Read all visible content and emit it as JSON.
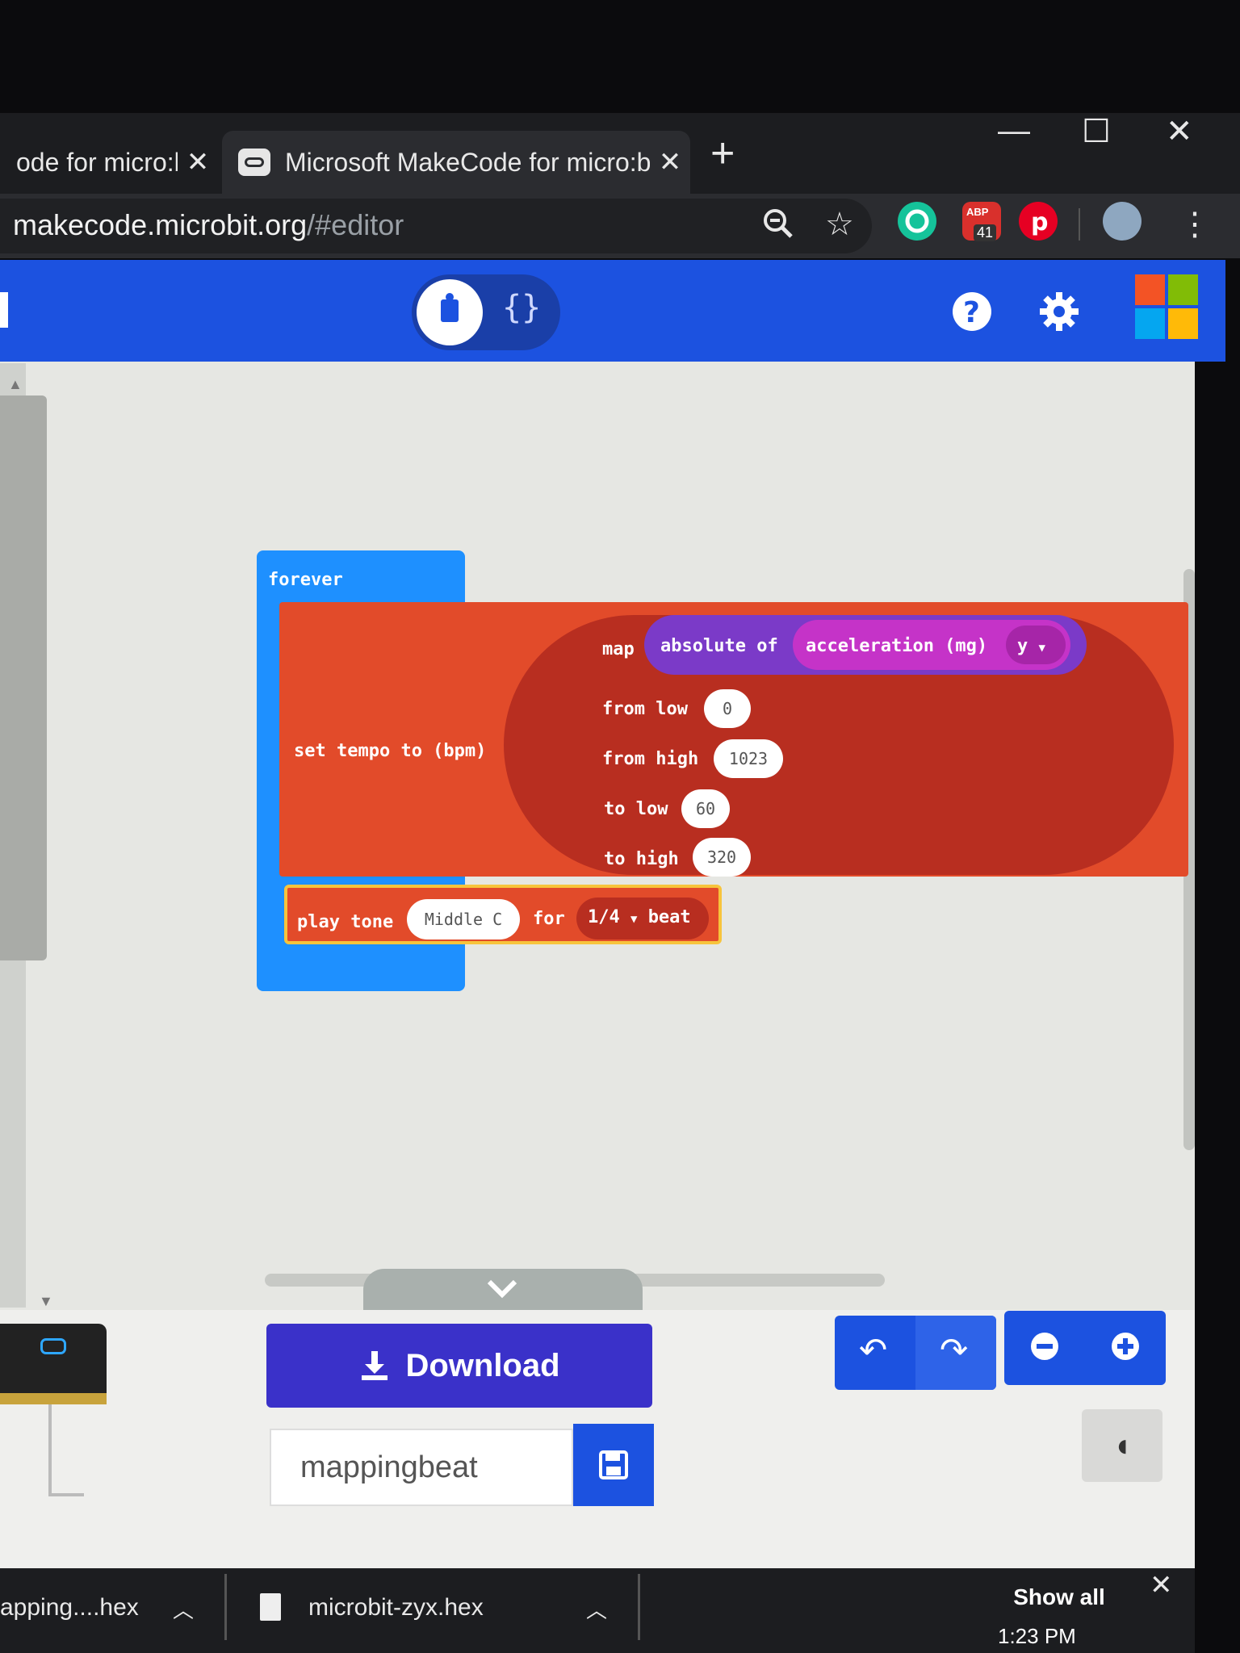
{
  "browser": {
    "tabs": [
      {
        "title": "ode for micro:bi",
        "active": false
      },
      {
        "title": "Microsoft MakeCode for micro:bi",
        "active": true
      }
    ],
    "new_tab": "+",
    "address": {
      "host": "makecode.microbit.org",
      "path": "/#editor"
    },
    "extension_badge": "41",
    "extension_abp_text": "ABP",
    "window_controls": {
      "minimize": "—",
      "maximize": "☐",
      "close": "✕"
    }
  },
  "makecode": {
    "header": {
      "mode_toggle": {
        "blocks_icon": "puzzle-icon",
        "text_icon": "{}"
      },
      "help": "?",
      "settings": "gear-icon"
    },
    "blocks": {
      "forever": "forever",
      "set_tempo": "set tempo to (bpm)",
      "map": {
        "label": "map",
        "absolute": "absolute of",
        "acceleration": "acceleration (mg)",
        "axis": "y",
        "from_low_label": "from low",
        "from_low": "0",
        "from_high_label": "from high",
        "from_high": "1023",
        "to_low_label": "to low",
        "to_low": "60",
        "to_high_label": "to high",
        "to_high": "320"
      },
      "play_tone": {
        "label": "play tone",
        "note": "Middle C",
        "for_label": "for",
        "beat_value": "1/4",
        "beat_label": "beat"
      }
    },
    "bottom": {
      "download": "Download",
      "project_name": "mappingbeat"
    }
  },
  "downloads": {
    "items": [
      "apping....hex",
      "microbit-zyx.hex"
    ],
    "show_all": "Show all"
  },
  "taskbar": {
    "time": "1:23 PM"
  },
  "colors": {
    "makecode_blue": "#1c52e0",
    "music_red": "#e24b2a",
    "map_dark": "#b82e20",
    "math_purple": "#7b3ac8",
    "input_pink": "#c533c8",
    "loops_blue": "#1e90ff",
    "download_purple": "#3a31c9"
  }
}
